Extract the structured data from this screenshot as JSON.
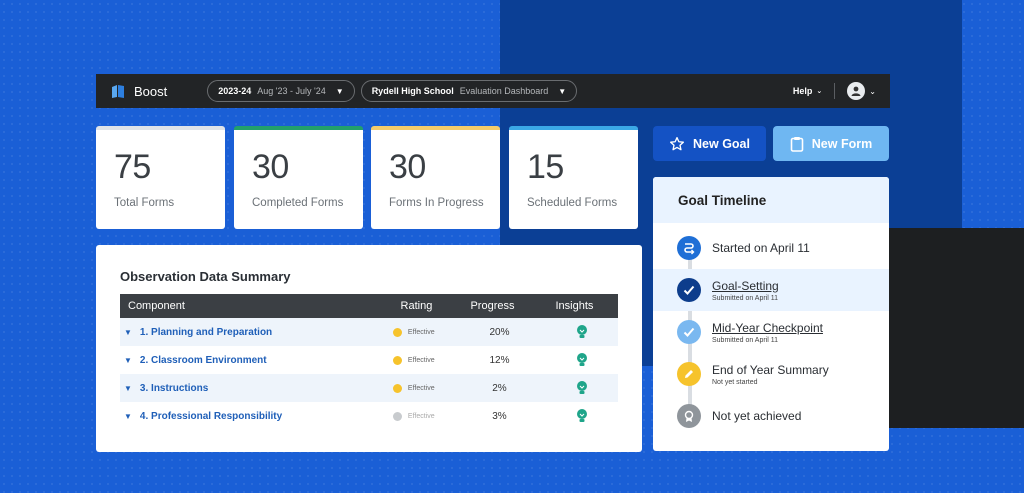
{
  "app": {
    "name": "Boost"
  },
  "header": {
    "year_label": "2023-24",
    "year_range": "Aug '23 - July '24",
    "school": "Rydell High School",
    "dashboard": "Evaluation Dashboard",
    "help_label": "Help"
  },
  "stats": [
    {
      "value": "75",
      "label": "Total Forms",
      "accent": "#dfe3e8"
    },
    {
      "value": "30",
      "label": "Completed Forms",
      "accent": "#22a06b"
    },
    {
      "value": "30",
      "label": "Forms In Progress",
      "accent": "#f5cc6a"
    },
    {
      "value": "15",
      "label": "Scheduled Forms",
      "accent": "#3ba8e6"
    }
  ],
  "actions": {
    "new_goal": "New Goal",
    "new_form": "New Form",
    "new_goal_color": "#1452c4",
    "new_form_color": "#6fb7f2"
  },
  "observation": {
    "title": "Observation Data Summary",
    "columns": [
      "Component",
      "Rating",
      "Progress",
      "Insights"
    ],
    "rows": [
      {
        "component": "1. Planning and Preparation",
        "rating": "Effective",
        "progress": "20%",
        "rating_color": "#f6c32c"
      },
      {
        "component": "2. Classroom Environment",
        "rating": "Effective",
        "progress": "12%",
        "rating_color": "#f6c32c"
      },
      {
        "component": "3. Instructions",
        "rating": "Effective",
        "progress": "2%",
        "rating_color": "#f6c32c"
      },
      {
        "component": "4. Professional Responsibility",
        "rating": "Effective",
        "progress": "3%",
        "rating_color": "#c8cbce"
      }
    ]
  },
  "timeline": {
    "title": "Goal Timeline",
    "items": [
      {
        "title": "Started on April 11",
        "sub": "",
        "icon": "route-icon"
      },
      {
        "title": "Goal-Setting",
        "sub": "Submitted on April 11",
        "icon": "check-icon"
      },
      {
        "title": "Mid-Year Checkpoint",
        "sub": "Submitted on April 11",
        "icon": "check-icon"
      },
      {
        "title": "End of Year Summary",
        "sub": "Not yet started",
        "icon": "pencil-icon"
      },
      {
        "title": "Not yet achieved",
        "sub": "",
        "icon": "award-icon"
      }
    ]
  }
}
